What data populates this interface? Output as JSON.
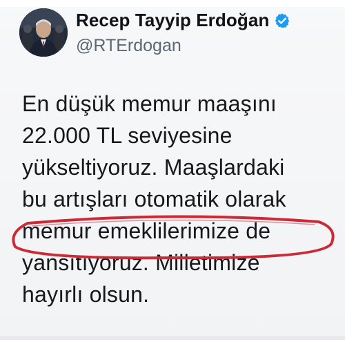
{
  "tweet": {
    "display_name": "Recep Tayyip Erdoğan",
    "handle": "@RTErdogan",
    "verified": true,
    "verified_color": "#1d9bf0",
    "lines": [
      "En düşük memur maaşını",
      "22.000 TL seviyesine",
      "yükseltiyoruz. Maaşlardaki",
      "bu artışları otomatik olarak",
      "memur emeklilerimize de",
      "yansıtıyoruz. Milletimize",
      "hayırlı olsun."
    ]
  },
  "annotation": {
    "type": "ellipse",
    "color": "#cc2a36",
    "highlighted_line_index": 4
  }
}
